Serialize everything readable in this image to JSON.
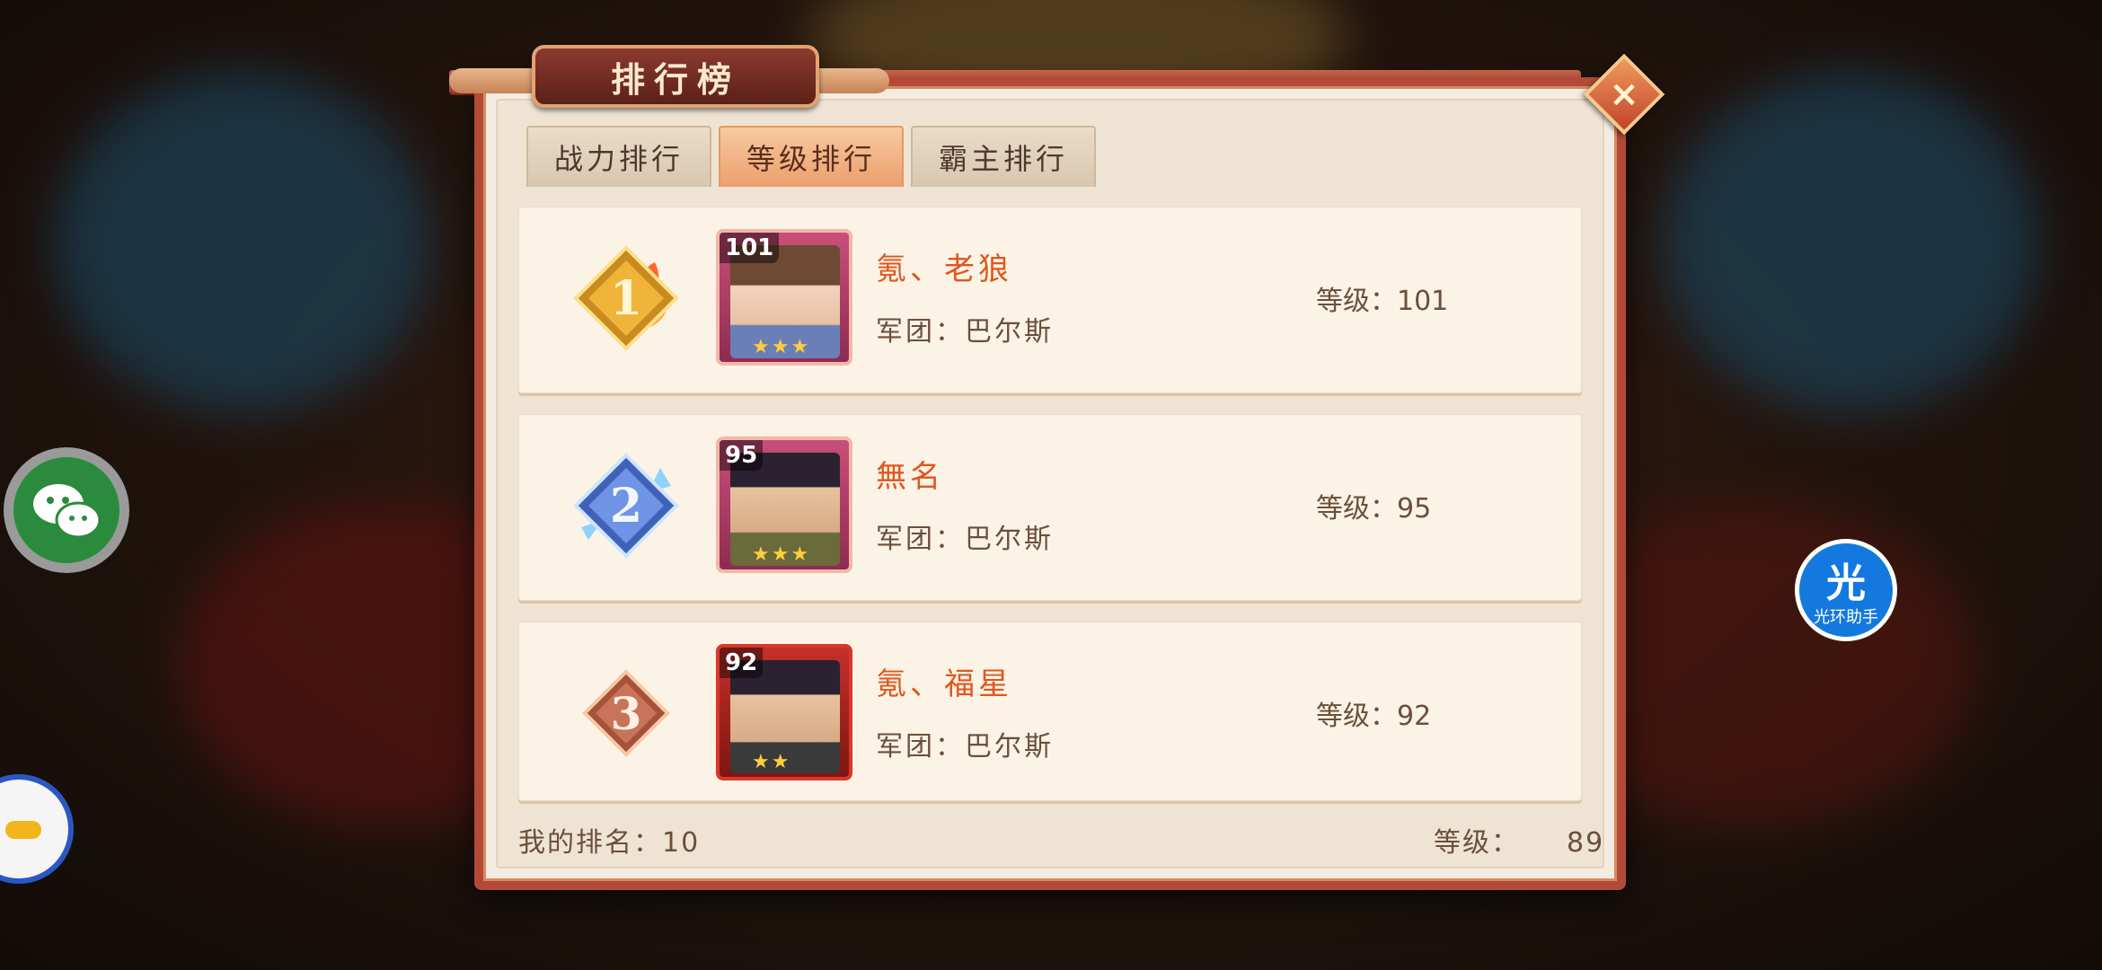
{
  "title": "排行榜",
  "close_label": "×",
  "tabs": [
    {
      "label": "战力排行",
      "active": false
    },
    {
      "label": "等级排行",
      "active": true
    },
    {
      "label": "霸主排行",
      "active": false
    }
  ],
  "entries": [
    {
      "rank": "1",
      "avatar_level": "101",
      "name": "氪、老狼",
      "guild": "军团：巴尔斯",
      "level_text": "等级：101"
    },
    {
      "rank": "2",
      "avatar_level": "95",
      "name": "無名",
      "guild": "军团：巴尔斯",
      "level_text": "等级：95"
    },
    {
      "rank": "3",
      "avatar_level": "92",
      "name": "氪、福星",
      "guild": "军团：巴尔斯",
      "level_text": "等级：92"
    }
  ],
  "footer": {
    "my_rank": "我的排名：10",
    "level_label": "等级：",
    "level_value": "89"
  },
  "assistant": {
    "big": "光",
    "small": "光环助手"
  },
  "icons": {
    "wechat": "wechat-icon",
    "halo": "halo-assistant-icon",
    "close": "close-icon"
  },
  "colors": {
    "panel_border": "#b24a37",
    "active_tab": "#ec9f6d",
    "player_name": "#e1561d"
  }
}
